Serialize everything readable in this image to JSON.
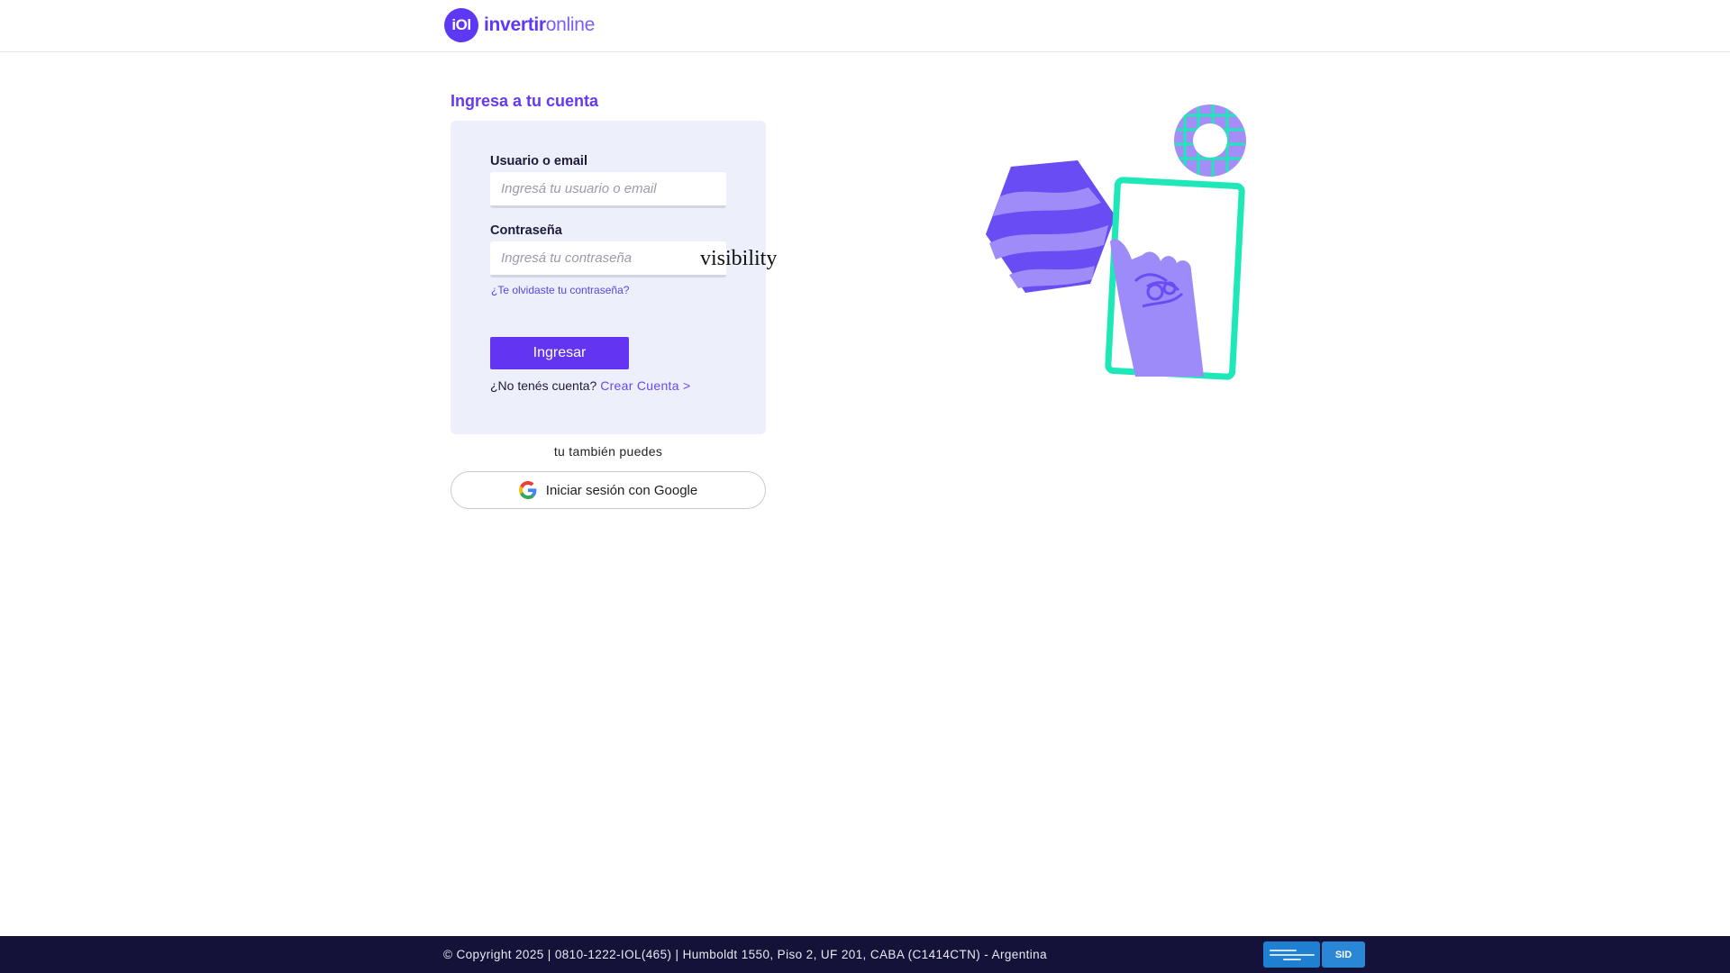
{
  "brand": {
    "mark": "iOl",
    "name_bold": "invertir",
    "name_light": "online",
    "color": "#5e38f5"
  },
  "login": {
    "title": "Ingresa a tu cuenta",
    "user_label": "Usuario o email",
    "user_placeholder": "Ingresá tu usuario o email",
    "user_value": "",
    "password_label": "Contraseña",
    "password_placeholder": "Ingresá tu contraseña",
    "password_value": "",
    "visibility_toggle": "visibility",
    "forgot_link": "¿Te olvidaste tu contraseña?",
    "submit_label": "Ingresar",
    "no_account_text": "¿No tenés cuenta?",
    "create_account_link": "Crear Cuenta >"
  },
  "alternatives": {
    "also_text": "tu también puedes",
    "google_button": "Iniciar sesión con Google"
  },
  "footer": {
    "text": "© Copyright 2025 | 0810-1222-IOL(465) | Humboldt 1550, Piso 2, UF 201, CABA (C1414CTN) - Argentina",
    "badge2_text": "SID"
  },
  "colors": {
    "accent": "#6334f1",
    "footer_bg": "#141238",
    "card_bg": "#edeffa",
    "mint": "#1ee8b7"
  }
}
